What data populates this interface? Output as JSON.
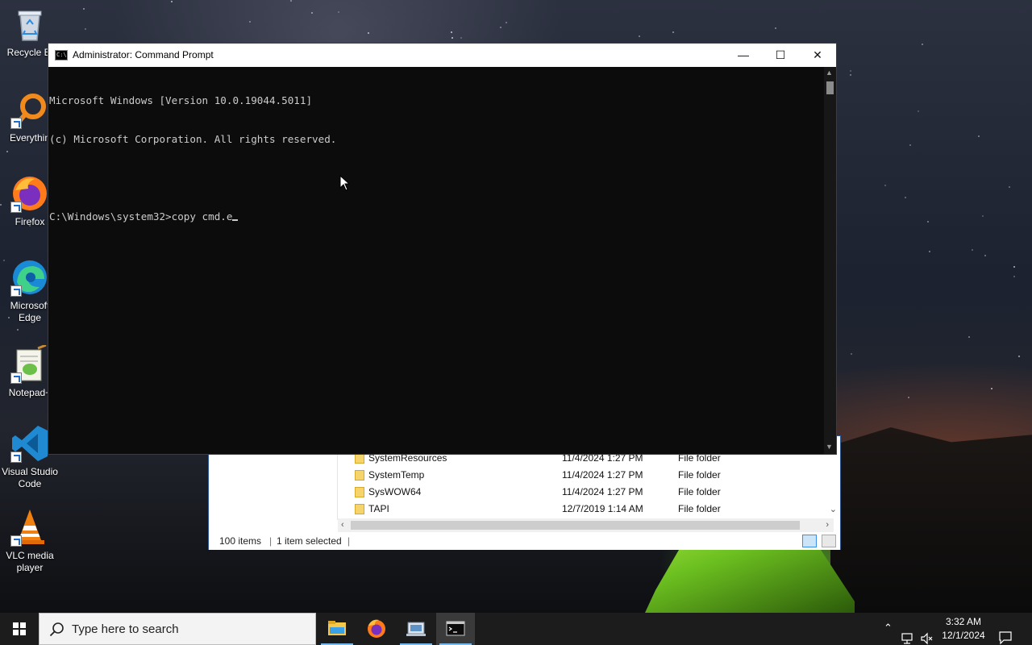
{
  "desktop": {
    "icons": [
      {
        "label": "Recycle Bi",
        "icon": "recycle-bin-icon"
      },
      {
        "label": "Everythin",
        "icon": "everything-search-icon"
      },
      {
        "label": "Firefox",
        "icon": "firefox-icon"
      },
      {
        "label": "Microsoft Edge",
        "icon": "edge-icon"
      },
      {
        "label": "Notepad+",
        "icon": "notepad-plus-plus-icon"
      },
      {
        "label": "Visual Studio Code",
        "icon": "vscode-icon"
      },
      {
        "label": "VLC media player",
        "icon": "vlc-icon"
      }
    ]
  },
  "cmd": {
    "title": "Administrator: Command Prompt",
    "minimize": "—",
    "maximize": "☐",
    "close": "✕",
    "lines": [
      "Microsoft Windows [Version 10.0.19044.5011]",
      "(c) Microsoft Corporation. All rights reserved.",
      "",
      "C:\\Windows\\system32>copy cmd.e"
    ]
  },
  "explorer": {
    "rows": [
      {
        "name": "SystemResources",
        "date": "11/4/2024 1:27 PM",
        "type": "File folder"
      },
      {
        "name": "SystemTemp",
        "date": "11/4/2024 1:27 PM",
        "type": "File folder"
      },
      {
        "name": "SysWOW64",
        "date": "11/4/2024 1:27 PM",
        "type": "File folder"
      },
      {
        "name": "TAPI",
        "date": "12/7/2019 1:14 AM",
        "type": "File folder"
      }
    ],
    "status": {
      "items": "100 items",
      "selected": "1 item selected"
    }
  },
  "taskbar": {
    "search_placeholder": "Type here to search",
    "apps": [
      {
        "name": "file-explorer",
        "active": false
      },
      {
        "name": "firefox",
        "active": false
      },
      {
        "name": "control-panel",
        "active": false
      },
      {
        "name": "command-prompt",
        "active": true
      }
    ],
    "time": "3:32 AM",
    "date": "12/1/2024"
  }
}
